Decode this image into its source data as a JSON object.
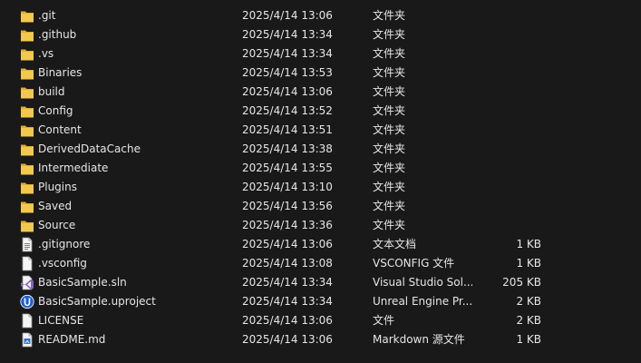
{
  "colors": {
    "background": "#191919",
    "text": "#e6e6e6",
    "folder": "#f2c94c"
  },
  "files": [
    {
      "name": ".git",
      "modified": "2025/4/14 13:06",
      "type": "文件夹",
      "size": "",
      "icon": "folder-icon"
    },
    {
      "name": ".github",
      "modified": "2025/4/14 13:34",
      "type": "文件夹",
      "size": "",
      "icon": "folder-icon"
    },
    {
      "name": ".vs",
      "modified": "2025/4/14 13:34",
      "type": "文件夹",
      "size": "",
      "icon": "folder-icon"
    },
    {
      "name": "Binaries",
      "modified": "2025/4/14 13:53",
      "type": "文件夹",
      "size": "",
      "icon": "folder-icon"
    },
    {
      "name": "build",
      "modified": "2025/4/14 13:06",
      "type": "文件夹",
      "size": "",
      "icon": "folder-icon"
    },
    {
      "name": "Config",
      "modified": "2025/4/14 13:52",
      "type": "文件夹",
      "size": "",
      "icon": "folder-icon"
    },
    {
      "name": "Content",
      "modified": "2025/4/14 13:51",
      "type": "文件夹",
      "size": "",
      "icon": "folder-icon"
    },
    {
      "name": "DerivedDataCache",
      "modified": "2025/4/14 13:38",
      "type": "文件夹",
      "size": "",
      "icon": "folder-icon"
    },
    {
      "name": "Intermediate",
      "modified": "2025/4/14 13:55",
      "type": "文件夹",
      "size": "",
      "icon": "folder-icon"
    },
    {
      "name": "Plugins",
      "modified": "2025/4/14 13:10",
      "type": "文件夹",
      "size": "",
      "icon": "folder-icon"
    },
    {
      "name": "Saved",
      "modified": "2025/4/14 13:56",
      "type": "文件夹",
      "size": "",
      "icon": "folder-icon"
    },
    {
      "name": "Source",
      "modified": "2025/4/14 13:36",
      "type": "文件夹",
      "size": "",
      "icon": "folder-icon"
    },
    {
      "name": ".gitignore",
      "modified": "2025/4/14 13:06",
      "type": "文本文档",
      "size": "1 KB",
      "icon": "text-file-icon"
    },
    {
      "name": ".vsconfig",
      "modified": "2025/4/14 13:08",
      "type": "VSCONFIG 文件",
      "size": "1 KB",
      "icon": "generic-file-icon"
    },
    {
      "name": "BasicSample.sln",
      "modified": "2025/4/14 13:34",
      "type": "Visual Studio Sol...",
      "size": "205 KB",
      "icon": "visual-studio-solution-icon"
    },
    {
      "name": "BasicSample.uproject",
      "modified": "2025/4/14 13:34",
      "type": "Unreal Engine Pr...",
      "size": "2 KB",
      "icon": "unreal-project-icon"
    },
    {
      "name": "LICENSE",
      "modified": "2025/4/14 13:06",
      "type": "文件",
      "size": "2 KB",
      "icon": "generic-file-icon"
    },
    {
      "name": "README.md",
      "modified": "2025/4/14 13:06",
      "type": "Markdown 源文件",
      "size": "1 KB",
      "icon": "markdown-file-icon"
    }
  ]
}
